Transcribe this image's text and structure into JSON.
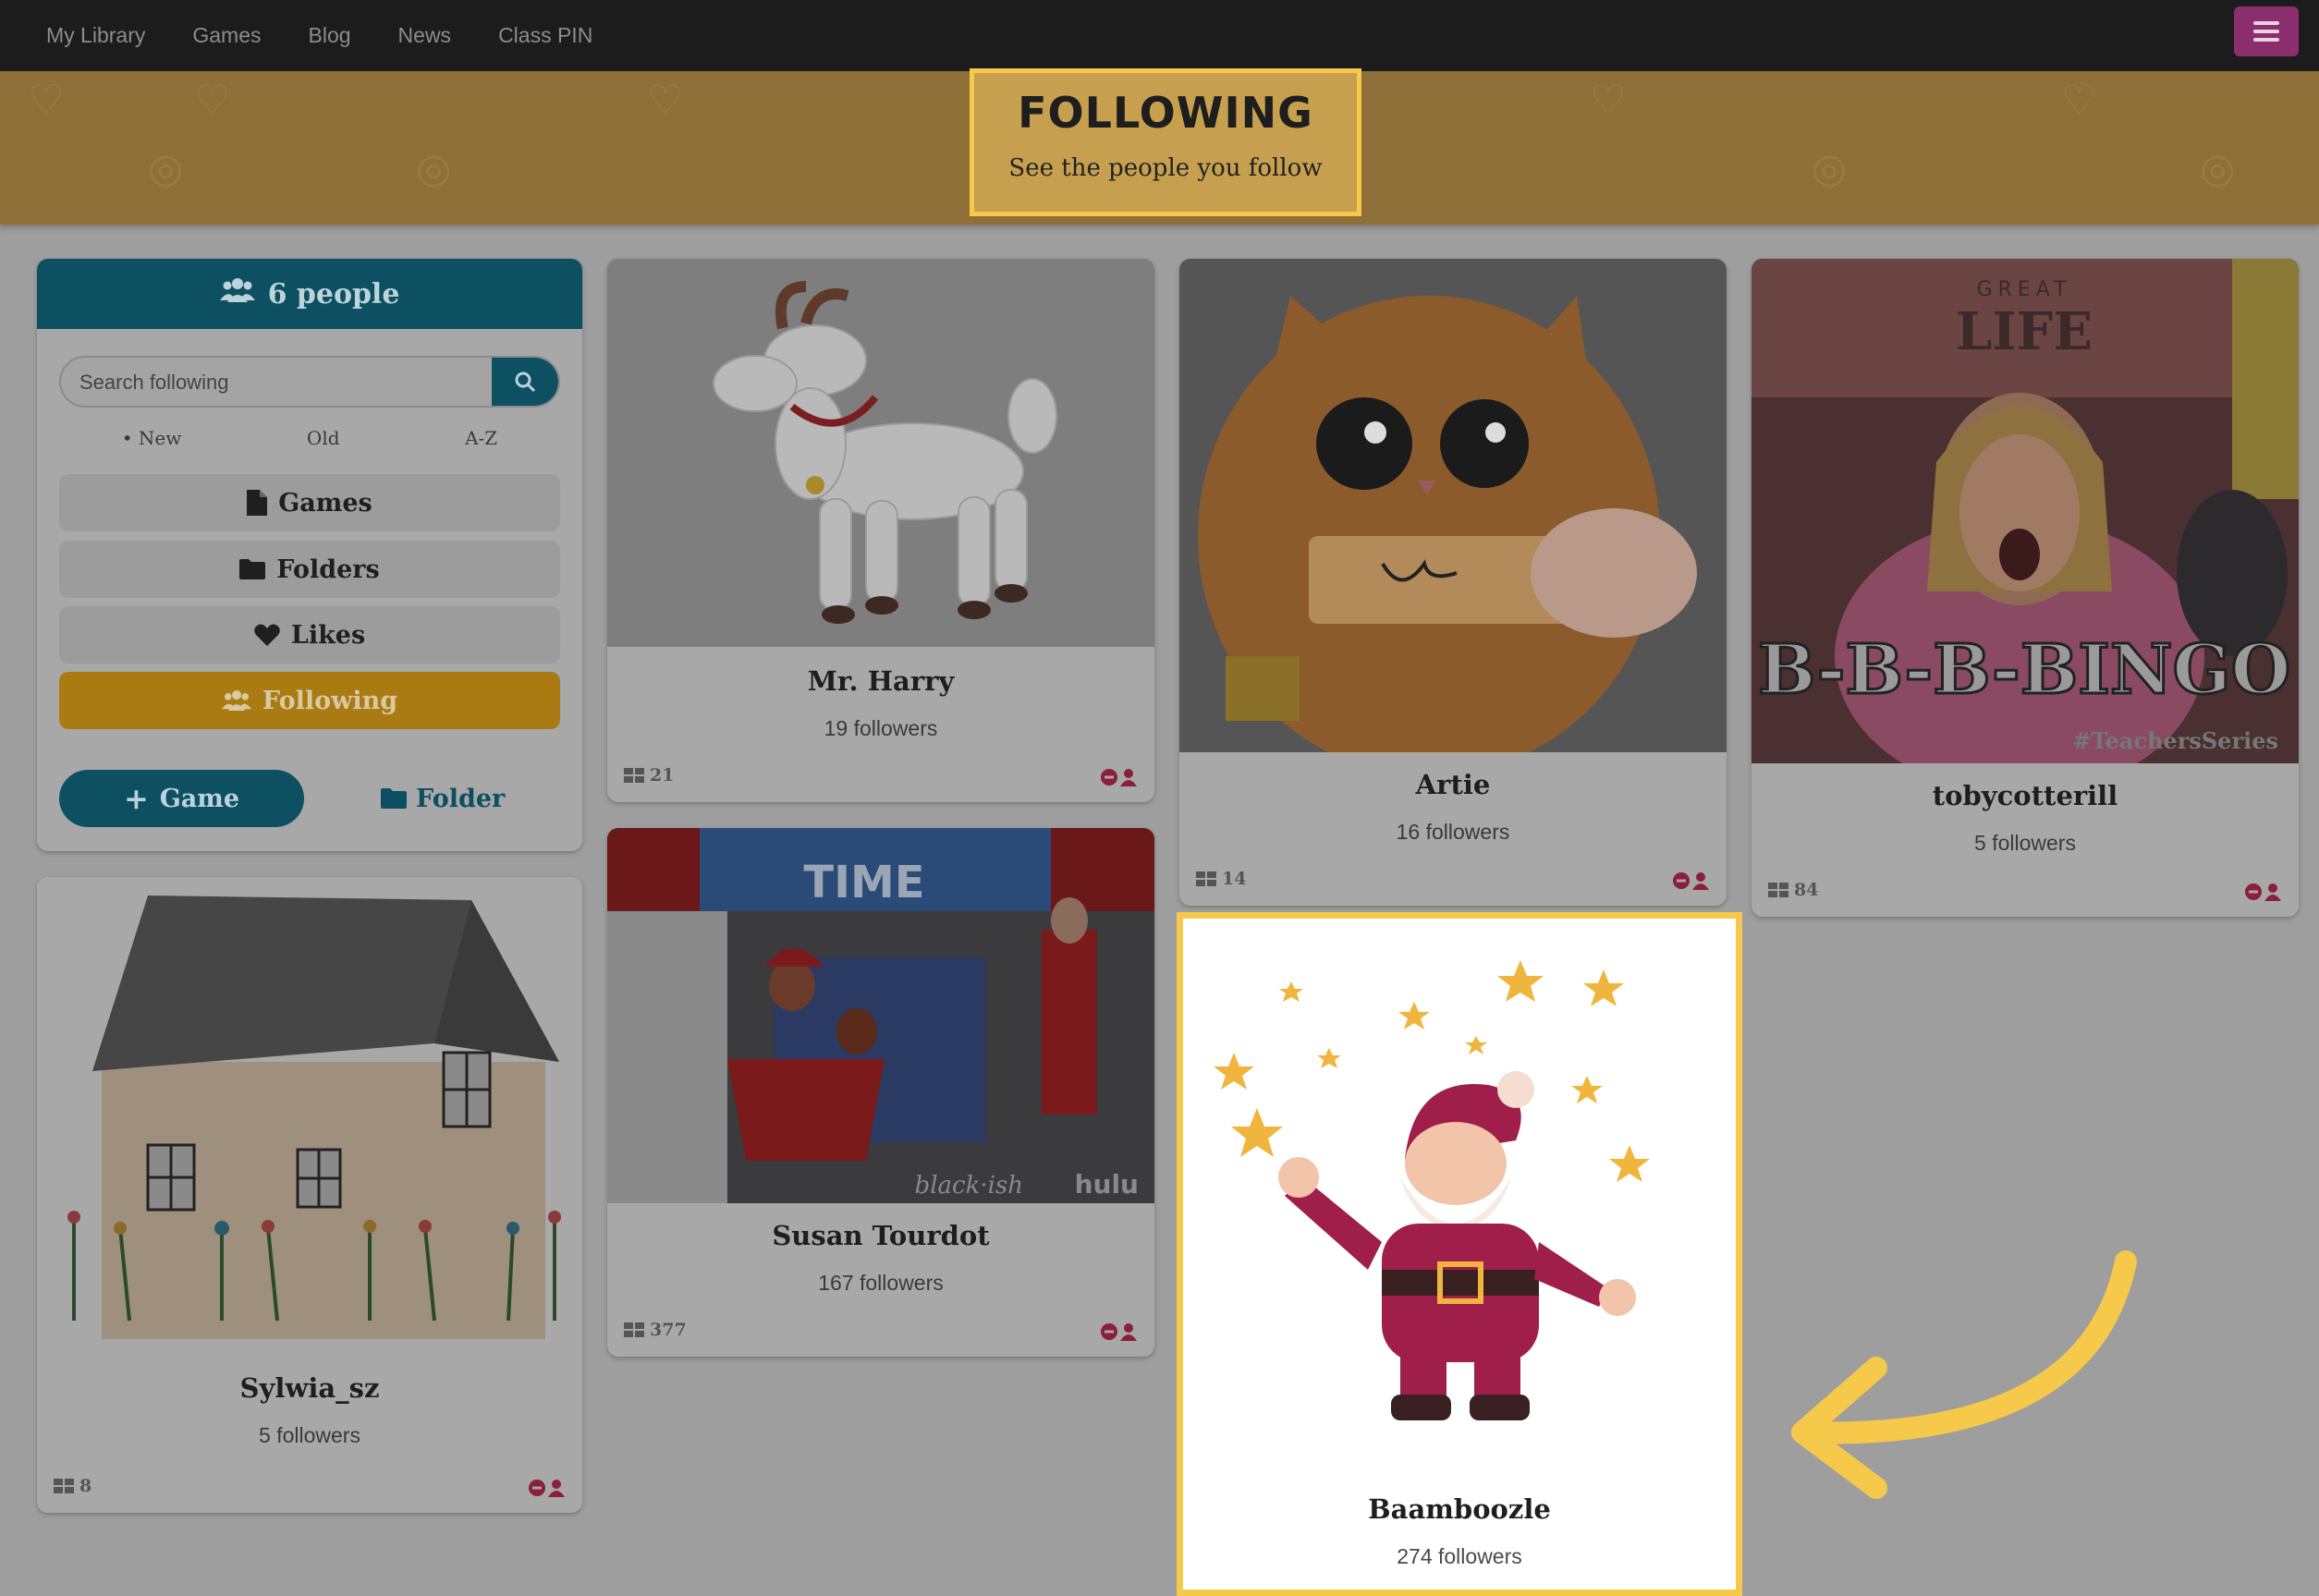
{
  "nav": {
    "links": [
      "My Library",
      "Games",
      "Blog",
      "News",
      "Class PIN"
    ]
  },
  "banner": {
    "title": "FOLLOWING",
    "subtitle": "See the people you follow"
  },
  "sidebar": {
    "people_count": "6 people",
    "search_placeholder": "Search following",
    "sort": {
      "new": "• New",
      "old": "Old",
      "az": "A-Z"
    },
    "buttons": {
      "games": "Games",
      "folders": "Folders",
      "likes": "Likes",
      "following": "Following"
    },
    "add_game": "Game",
    "add_folder": "Folder"
  },
  "cards": [
    {
      "name": "Mr. Harry",
      "followers": "19 followers",
      "games": "21"
    },
    {
      "name": "Artie",
      "followers": "16 followers",
      "games": "14"
    },
    {
      "name": "tobycotterill",
      "followers": "5 followers",
      "games": "84"
    },
    {
      "name": "Susan Tourdot",
      "followers": "167 followers",
      "games": "377"
    },
    {
      "name": "Sylwia_sz",
      "followers": "5 followers",
      "games": "8"
    },
    {
      "name": "Baamboozle",
      "followers": "274 followers"
    }
  ],
  "image_text": {
    "bingo": "B-B-B-BINGO",
    "teachers_series": "#TeachersSeries",
    "great_life": "GREAT",
    "life": "LIFE",
    "time": "TIME",
    "blackish": "black·ish",
    "hulu": "hulu"
  },
  "colors": {
    "teal": "#0d5062",
    "gold": "#f6c94b",
    "following_active": "#a97b12",
    "unfollow": "#8a1f3f"
  }
}
